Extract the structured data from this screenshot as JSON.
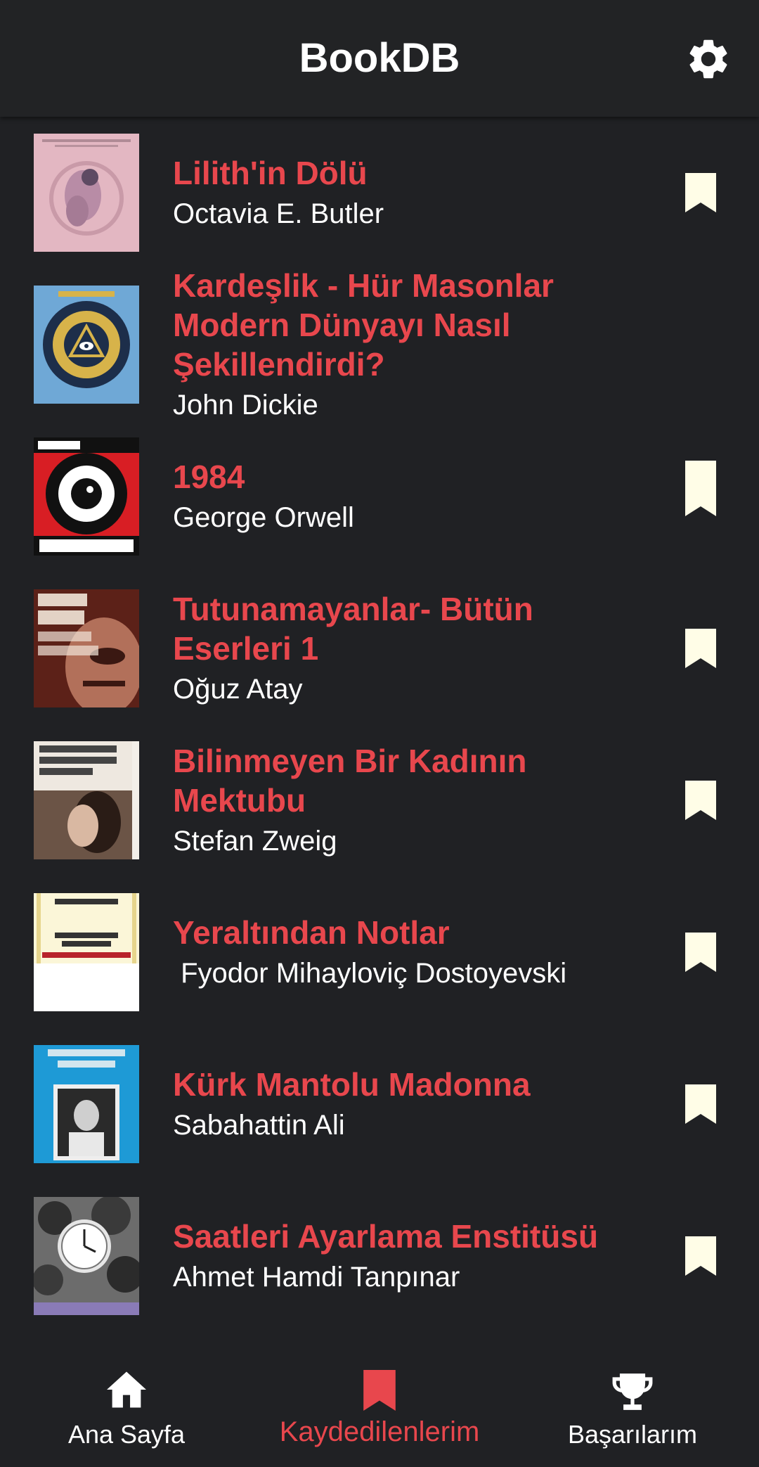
{
  "app": {
    "title": "BookDB",
    "settings_icon": "gear-icon",
    "accent_color": "#e8474d",
    "bookmark_color": "#fffde7"
  },
  "books": [
    {
      "title": "Lilith'in Dölü",
      "author": "Octavia E. Butler",
      "saved": true
    },
    {
      "title": "Kardeşlik - Hür Masonlar Modern Dünyayı Nasıl Şekillendirdi?",
      "author": "John Dickie",
      "saved": true
    },
    {
      "title": "1984",
      "author": "George Orwell",
      "saved": true
    },
    {
      "title": "Tutunamayanlar- Bütün Eserleri 1",
      "author": "Oğuz Atay",
      "saved": true
    },
    {
      "title": "Bilinmeyen Bir Kadının Mektubu",
      "author": "Stefan Zweig",
      "saved": true
    },
    {
      "title": "Yeraltından Notlar",
      "author": " Fyodor Mihayloviç Dostoyevski",
      "saved": true
    },
    {
      "title": "Kürk Mantolu Madonna",
      "author": "Sabahattin Ali",
      "saved": true
    },
    {
      "title": "Saatleri Ayarlama Enstitüsü",
      "author": "Ahmet Hamdi Tanpınar",
      "saved": true
    }
  ],
  "nav": {
    "items": [
      {
        "label": "Ana Sayfa",
        "icon": "home-icon",
        "active": false
      },
      {
        "label": "Kaydedilenlerim",
        "icon": "bookmark-icon",
        "active": true
      },
      {
        "label": "Başarılarım",
        "icon": "trophy-icon",
        "active": false
      }
    ]
  }
}
